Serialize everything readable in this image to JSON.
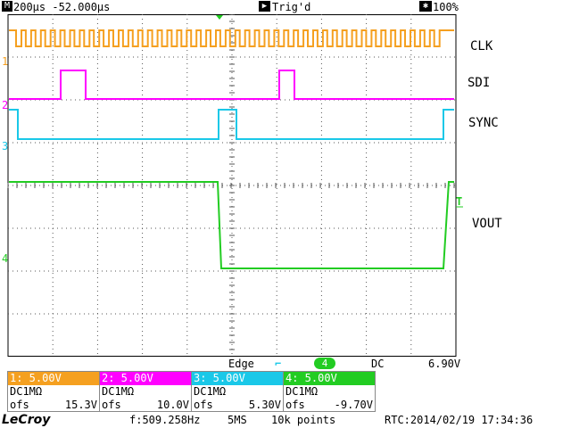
{
  "timebase": {
    "icon": "M",
    "scale": "200µs",
    "delay": "-52.000µs"
  },
  "trigger_status": {
    "icon": "▶",
    "text": "Trig'd"
  },
  "zoom": {
    "icon": "✱",
    "text": "100%"
  },
  "channels": [
    {
      "num": "1",
      "name": "CLK",
      "color": "#f5a020",
      "scale": "1: 5.00V",
      "coupling": "DC1MΩ",
      "ofs_label": "ofs",
      "ofs_value": "15.3V"
    },
    {
      "num": "2",
      "name": "SDI",
      "color": "#ff00ff",
      "scale": "2: 5.00V",
      "coupling": "DC1MΩ",
      "ofs_label": "ofs",
      "ofs_value": "10.0V"
    },
    {
      "num": "3",
      "name": "SYNC",
      "color": "#1ac8e8",
      "scale": "3: 5.00V",
      "coupling": "DC1MΩ",
      "ofs_label": "ofs",
      "ofs_value": "5.30V"
    },
    {
      "num": "4",
      "name": "VOUT",
      "color": "#22cc22",
      "scale": "4: 5.00V",
      "coupling": "DC1MΩ",
      "ofs_label": "ofs",
      "ofs_value": "-9.70V"
    }
  ],
  "trigger_marker": "T",
  "trigger_info": {
    "mode": "Edge",
    "slope": "⌐",
    "source": "4",
    "coupling": "DC",
    "level": "6.90V"
  },
  "footer": {
    "brand": "LeCroy",
    "frequency": "f:509.258Hz",
    "sample_rate": "5MS",
    "points": "10k points",
    "rtc": "RTC:2014/02/19 17:34:36"
  },
  "colors": {
    "grid": "#555555",
    "background": "#ffffff"
  }
}
